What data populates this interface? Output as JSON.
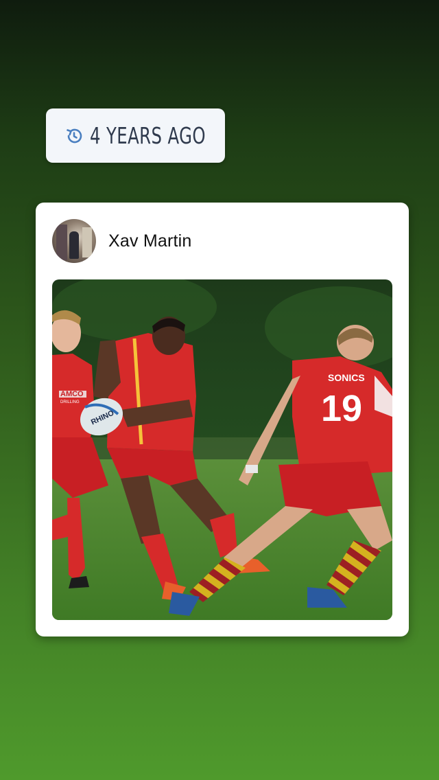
{
  "memory": {
    "label": "4 YEARS AGO",
    "icon": "history-icon"
  },
  "post": {
    "author": "Xav Martin",
    "photo_text": {
      "sponsor": "AMCO",
      "sponsor_sub": "DRILLING",
      "ball_brand": "RHINO",
      "shirt_name": "SONICS",
      "shirt_number": "19"
    }
  },
  "colors": {
    "badge_bg": "#f3f6fa",
    "badge_text": "#2f3a4d",
    "icon": "#4a7fc0",
    "card_bg": "#ffffff"
  }
}
